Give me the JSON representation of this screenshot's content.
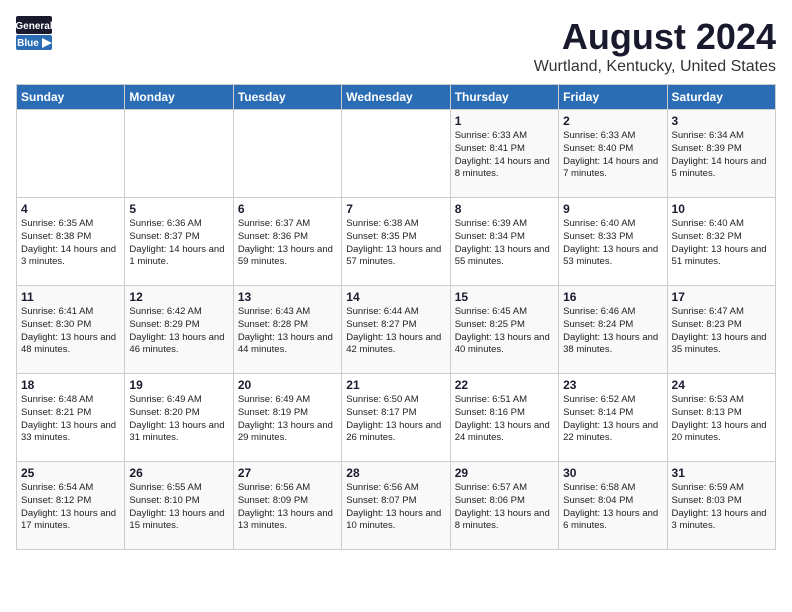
{
  "header": {
    "logo_general": "General",
    "logo_blue": "Blue",
    "title": "August 2024",
    "subtitle": "Wurtland, Kentucky, United States"
  },
  "days_of_week": [
    "Sunday",
    "Monday",
    "Tuesday",
    "Wednesday",
    "Thursday",
    "Friday",
    "Saturday"
  ],
  "weeks": [
    [
      {
        "day": "",
        "sunrise": "",
        "sunset": "",
        "daylight": ""
      },
      {
        "day": "",
        "sunrise": "",
        "sunset": "",
        "daylight": ""
      },
      {
        "day": "",
        "sunrise": "",
        "sunset": "",
        "daylight": ""
      },
      {
        "day": "",
        "sunrise": "",
        "sunset": "",
        "daylight": ""
      },
      {
        "day": "1",
        "sunrise": "Sunrise: 6:33 AM",
        "sunset": "Sunset: 8:41 PM",
        "daylight": "Daylight: 14 hours and 8 minutes."
      },
      {
        "day": "2",
        "sunrise": "Sunrise: 6:33 AM",
        "sunset": "Sunset: 8:40 PM",
        "daylight": "Daylight: 14 hours and 7 minutes."
      },
      {
        "day": "3",
        "sunrise": "Sunrise: 6:34 AM",
        "sunset": "Sunset: 8:39 PM",
        "daylight": "Daylight: 14 hours and 5 minutes."
      }
    ],
    [
      {
        "day": "4",
        "sunrise": "Sunrise: 6:35 AM",
        "sunset": "Sunset: 8:38 PM",
        "daylight": "Daylight: 14 hours and 3 minutes."
      },
      {
        "day": "5",
        "sunrise": "Sunrise: 6:36 AM",
        "sunset": "Sunset: 8:37 PM",
        "daylight": "Daylight: 14 hours and 1 minute."
      },
      {
        "day": "6",
        "sunrise": "Sunrise: 6:37 AM",
        "sunset": "Sunset: 8:36 PM",
        "daylight": "Daylight: 13 hours and 59 minutes."
      },
      {
        "day": "7",
        "sunrise": "Sunrise: 6:38 AM",
        "sunset": "Sunset: 8:35 PM",
        "daylight": "Daylight: 13 hours and 57 minutes."
      },
      {
        "day": "8",
        "sunrise": "Sunrise: 6:39 AM",
        "sunset": "Sunset: 8:34 PM",
        "daylight": "Daylight: 13 hours and 55 minutes."
      },
      {
        "day": "9",
        "sunrise": "Sunrise: 6:40 AM",
        "sunset": "Sunset: 8:33 PM",
        "daylight": "Daylight: 13 hours and 53 minutes."
      },
      {
        "day": "10",
        "sunrise": "Sunrise: 6:40 AM",
        "sunset": "Sunset: 8:32 PM",
        "daylight": "Daylight: 13 hours and 51 minutes."
      }
    ],
    [
      {
        "day": "11",
        "sunrise": "Sunrise: 6:41 AM",
        "sunset": "Sunset: 8:30 PM",
        "daylight": "Daylight: 13 hours and 48 minutes."
      },
      {
        "day": "12",
        "sunrise": "Sunrise: 6:42 AM",
        "sunset": "Sunset: 8:29 PM",
        "daylight": "Daylight: 13 hours and 46 minutes."
      },
      {
        "day": "13",
        "sunrise": "Sunrise: 6:43 AM",
        "sunset": "Sunset: 8:28 PM",
        "daylight": "Daylight: 13 hours and 44 minutes."
      },
      {
        "day": "14",
        "sunrise": "Sunrise: 6:44 AM",
        "sunset": "Sunset: 8:27 PM",
        "daylight": "Daylight: 13 hours and 42 minutes."
      },
      {
        "day": "15",
        "sunrise": "Sunrise: 6:45 AM",
        "sunset": "Sunset: 8:25 PM",
        "daylight": "Daylight: 13 hours and 40 minutes."
      },
      {
        "day": "16",
        "sunrise": "Sunrise: 6:46 AM",
        "sunset": "Sunset: 8:24 PM",
        "daylight": "Daylight: 13 hours and 38 minutes."
      },
      {
        "day": "17",
        "sunrise": "Sunrise: 6:47 AM",
        "sunset": "Sunset: 8:23 PM",
        "daylight": "Daylight: 13 hours and 35 minutes."
      }
    ],
    [
      {
        "day": "18",
        "sunrise": "Sunrise: 6:48 AM",
        "sunset": "Sunset: 8:21 PM",
        "daylight": "Daylight: 13 hours and 33 minutes."
      },
      {
        "day": "19",
        "sunrise": "Sunrise: 6:49 AM",
        "sunset": "Sunset: 8:20 PM",
        "daylight": "Daylight: 13 hours and 31 minutes."
      },
      {
        "day": "20",
        "sunrise": "Sunrise: 6:49 AM",
        "sunset": "Sunset: 8:19 PM",
        "daylight": "Daylight: 13 hours and 29 minutes."
      },
      {
        "day": "21",
        "sunrise": "Sunrise: 6:50 AM",
        "sunset": "Sunset: 8:17 PM",
        "daylight": "Daylight: 13 hours and 26 minutes."
      },
      {
        "day": "22",
        "sunrise": "Sunrise: 6:51 AM",
        "sunset": "Sunset: 8:16 PM",
        "daylight": "Daylight: 13 hours and 24 minutes."
      },
      {
        "day": "23",
        "sunrise": "Sunrise: 6:52 AM",
        "sunset": "Sunset: 8:14 PM",
        "daylight": "Daylight: 13 hours and 22 minutes."
      },
      {
        "day": "24",
        "sunrise": "Sunrise: 6:53 AM",
        "sunset": "Sunset: 8:13 PM",
        "daylight": "Daylight: 13 hours and 20 minutes."
      }
    ],
    [
      {
        "day": "25",
        "sunrise": "Sunrise: 6:54 AM",
        "sunset": "Sunset: 8:12 PM",
        "daylight": "Daylight: 13 hours and 17 minutes."
      },
      {
        "day": "26",
        "sunrise": "Sunrise: 6:55 AM",
        "sunset": "Sunset: 8:10 PM",
        "daylight": "Daylight: 13 hours and 15 minutes."
      },
      {
        "day": "27",
        "sunrise": "Sunrise: 6:56 AM",
        "sunset": "Sunset: 8:09 PM",
        "daylight": "Daylight: 13 hours and 13 minutes."
      },
      {
        "day": "28",
        "sunrise": "Sunrise: 6:56 AM",
        "sunset": "Sunset: 8:07 PM",
        "daylight": "Daylight: 13 hours and 10 minutes."
      },
      {
        "day": "29",
        "sunrise": "Sunrise: 6:57 AM",
        "sunset": "Sunset: 8:06 PM",
        "daylight": "Daylight: 13 hours and 8 minutes."
      },
      {
        "day": "30",
        "sunrise": "Sunrise: 6:58 AM",
        "sunset": "Sunset: 8:04 PM",
        "daylight": "Daylight: 13 hours and 6 minutes."
      },
      {
        "day": "31",
        "sunrise": "Sunrise: 6:59 AM",
        "sunset": "Sunset: 8:03 PM",
        "daylight": "Daylight: 13 hours and 3 minutes."
      }
    ]
  ]
}
